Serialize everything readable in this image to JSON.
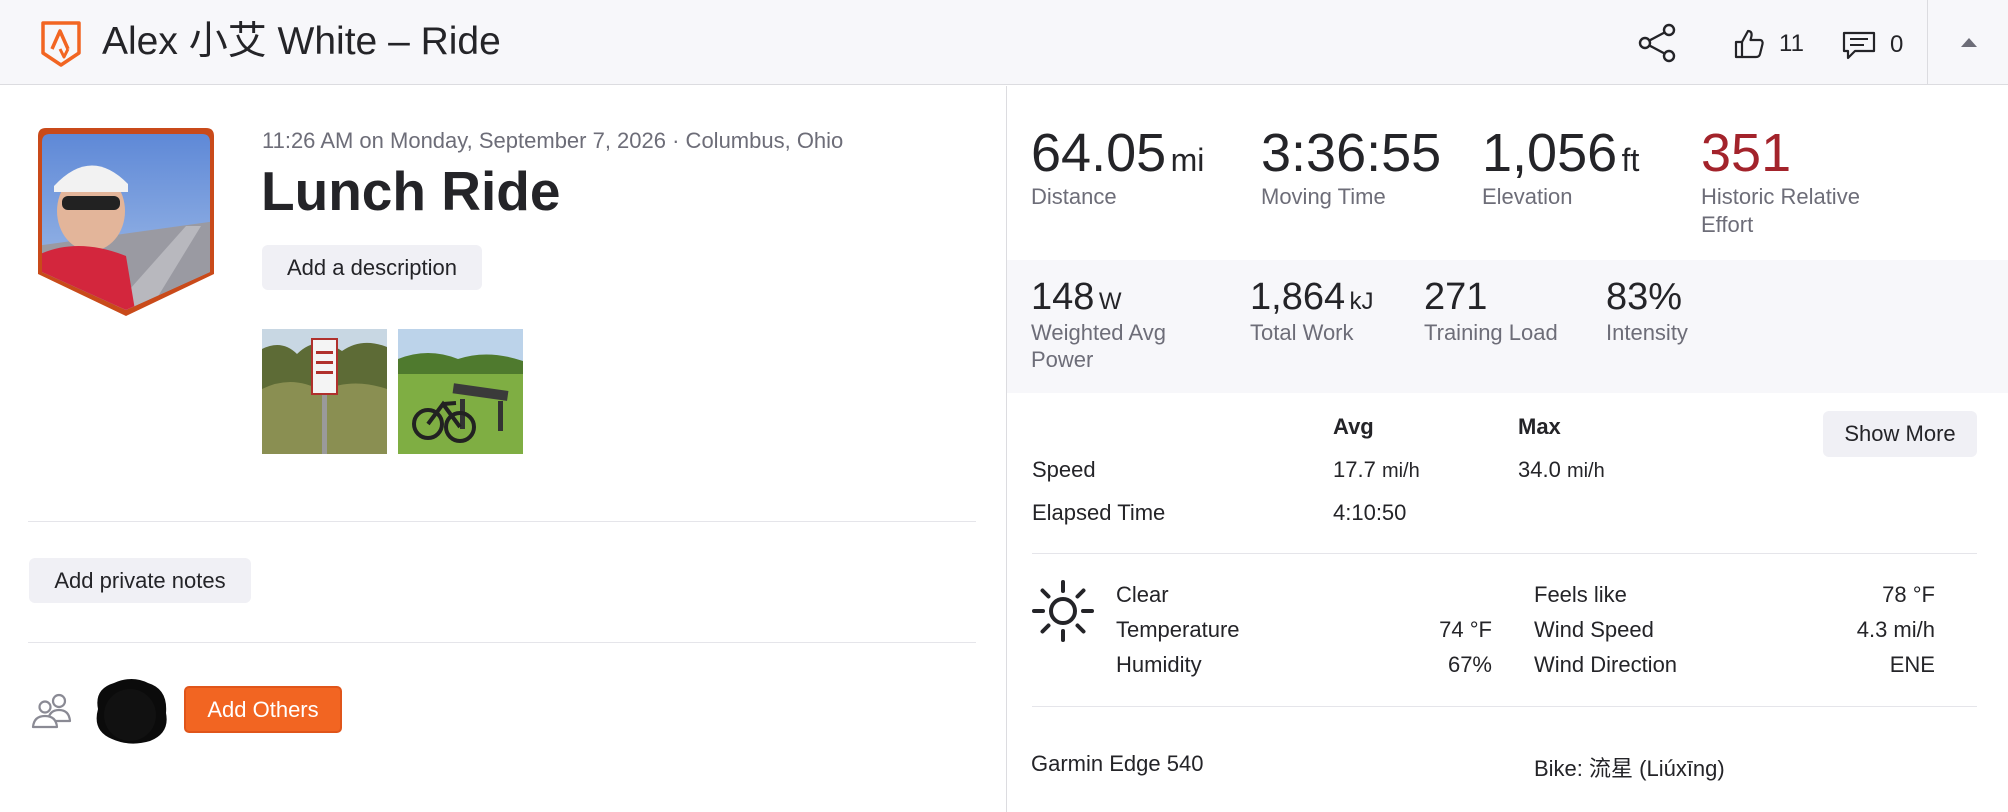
{
  "header": {
    "title": "Alex 小艾 White – Ride",
    "kudos_count": "11",
    "comment_count": "0",
    "brand_color": "#f26522"
  },
  "activity": {
    "datetime_location": "11:26 AM on Monday, September 7, 2026 · Columbus, Ohio",
    "title": "Lunch Ride",
    "add_description_label": "Add a description",
    "add_notes_label": "Add private notes",
    "add_others_label": "Add Others"
  },
  "stats": {
    "distance": {
      "value": "64.05",
      "unit": "mi",
      "label": "Distance"
    },
    "moving_time": {
      "value": "3:36:55",
      "label": "Moving Time"
    },
    "elevation": {
      "value": "1,056",
      "unit": "ft",
      "label": "Elevation"
    },
    "relative_effort": {
      "value": "351",
      "label_line1": "Historic Relative",
      "label_line2": "Effort",
      "color": "#a3232b"
    }
  },
  "secondary_stats": {
    "weighted_power": {
      "value": "148",
      "unit": "W",
      "label_line1": "Weighted Avg",
      "label_line2": "Power"
    },
    "total_work": {
      "value": "1,864",
      "unit": "kJ",
      "label": "Total Work"
    },
    "training_load": {
      "value": "271",
      "label": "Training Load"
    },
    "intensity": {
      "value": "83%",
      "label": "Intensity"
    }
  },
  "table": {
    "col_avg": "Avg",
    "col_max": "Max",
    "show_more_label": "Show More",
    "speed": {
      "label": "Speed",
      "avg": "17.7",
      "max": "34.0",
      "unit": "mi/h"
    },
    "elapsed": {
      "label": "Elapsed Time",
      "avg": "4:10:50"
    }
  },
  "weather": {
    "icon": "sun-icon",
    "condition": "Clear",
    "temperature": {
      "label": "Temperature",
      "value": "74 °F"
    },
    "humidity": {
      "label": "Humidity",
      "value": "67%"
    },
    "feels_like": {
      "label": "Feels like",
      "value": "78 °F"
    },
    "wind_speed": {
      "label": "Wind Speed",
      "value": "4.3 mi/h"
    },
    "wind_direction": {
      "label": "Wind Direction",
      "value": "ENE"
    }
  },
  "gear": {
    "device": "Garmin Edge 540",
    "bike": "Bike: 流星 (Liúxīng)"
  }
}
